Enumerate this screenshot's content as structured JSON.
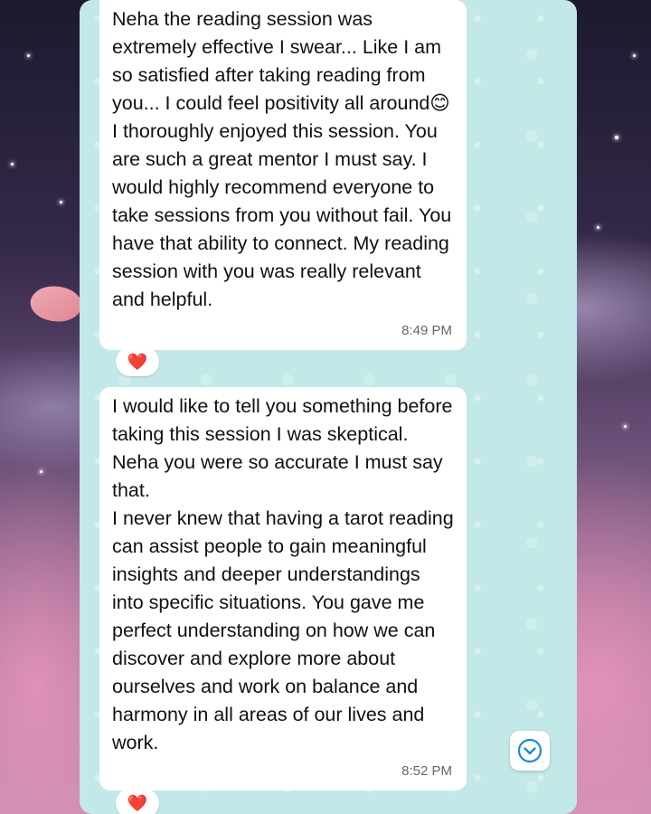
{
  "chat": {
    "messages": [
      {
        "text": "Neha the reading session was extremely effective I swear... Like I am so satisfied after taking reading from you... I could feel positivity all around😊I thoroughly enjoyed this session. You are such a great mentor I must say. I would highly recommend everyone to take sessions from you without fail. You have that ability to connect. My reading session with you was really relevant and helpful.",
        "time": "8:49 PM",
        "reaction": "❤️"
      },
      {
        "text": "I would like to tell you something before taking this session I was skeptical. Neha you were so accurate I must say that.\nI never knew that having a tarot reading can assist people to gain meaningful insights and deeper understandings into specific situations. You gave me perfect understanding on how we can discover and explore more about ourselves and work on balance and harmony in all areas of our lives and work.",
        "time": "8:52 PM",
        "reaction": "❤️"
      }
    ],
    "scroll_down_icon": "chevron-down-circle-icon"
  },
  "colors": {
    "wallpaper": "#c2e8e8",
    "bubble": "#ffffff",
    "accent": "#1a8ad6",
    "reaction_heart": "#e0212a"
  }
}
